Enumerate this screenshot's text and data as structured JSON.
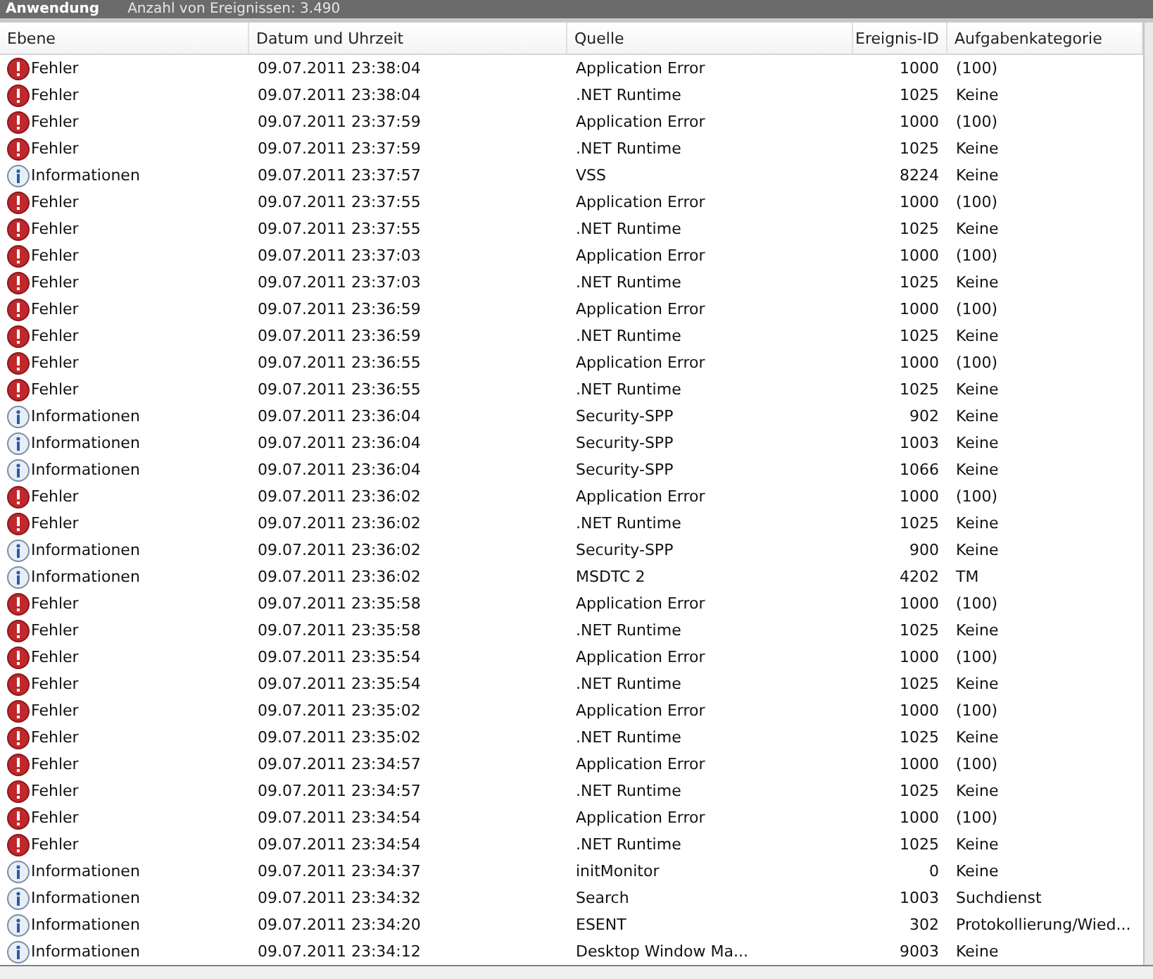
{
  "header": {
    "title": "Anwendung",
    "count": "Anzahl von Ereignissen: 3.490"
  },
  "table": {
    "columns": [
      "Ebene",
      "Datum und Uhrzeit",
      "Quelle",
      "Ereignis-ID",
      "Aufgabenkategorie"
    ],
    "rows": [
      {
        "kind": "error",
        "level": "Fehler",
        "date": "09.07.2011 23:38:04",
        "source": "Application Error",
        "id": "1000",
        "category": "(100)"
      },
      {
        "kind": "error",
        "level": "Fehler",
        "date": "09.07.2011 23:38:04",
        "source": ".NET Runtime",
        "id": "1025",
        "category": "Keine"
      },
      {
        "kind": "error",
        "level": "Fehler",
        "date": "09.07.2011 23:37:59",
        "source": "Application Error",
        "id": "1000",
        "category": "(100)"
      },
      {
        "kind": "error",
        "level": "Fehler",
        "date": "09.07.2011 23:37:59",
        "source": ".NET Runtime",
        "id": "1025",
        "category": "Keine"
      },
      {
        "kind": "info",
        "level": "Informationen",
        "date": "09.07.2011 23:37:57",
        "source": "VSS",
        "id": "8224",
        "category": "Keine"
      },
      {
        "kind": "error",
        "level": "Fehler",
        "date": "09.07.2011 23:37:55",
        "source": "Application Error",
        "id": "1000",
        "category": "(100)"
      },
      {
        "kind": "error",
        "level": "Fehler",
        "date": "09.07.2011 23:37:55",
        "source": ".NET Runtime",
        "id": "1025",
        "category": "Keine"
      },
      {
        "kind": "error",
        "level": "Fehler",
        "date": "09.07.2011 23:37:03",
        "source": "Application Error",
        "id": "1000",
        "category": "(100)"
      },
      {
        "kind": "error",
        "level": "Fehler",
        "date": "09.07.2011 23:37:03",
        "source": ".NET Runtime",
        "id": "1025",
        "category": "Keine"
      },
      {
        "kind": "error",
        "level": "Fehler",
        "date": "09.07.2011 23:36:59",
        "source": "Application Error",
        "id": "1000",
        "category": "(100)"
      },
      {
        "kind": "error",
        "level": "Fehler",
        "date": "09.07.2011 23:36:59",
        "source": ".NET Runtime",
        "id": "1025",
        "category": "Keine"
      },
      {
        "kind": "error",
        "level": "Fehler",
        "date": "09.07.2011 23:36:55",
        "source": "Application Error",
        "id": "1000",
        "category": "(100)"
      },
      {
        "kind": "error",
        "level": "Fehler",
        "date": "09.07.2011 23:36:55",
        "source": ".NET Runtime",
        "id": "1025",
        "category": "Keine"
      },
      {
        "kind": "info",
        "level": "Informationen",
        "date": "09.07.2011 23:36:04",
        "source": "Security-SPP",
        "id": "902",
        "category": "Keine"
      },
      {
        "kind": "info",
        "level": "Informationen",
        "date": "09.07.2011 23:36:04",
        "source": "Security-SPP",
        "id": "1003",
        "category": "Keine"
      },
      {
        "kind": "info",
        "level": "Informationen",
        "date": "09.07.2011 23:36:04",
        "source": "Security-SPP",
        "id": "1066",
        "category": "Keine"
      },
      {
        "kind": "error",
        "level": "Fehler",
        "date": "09.07.2011 23:36:02",
        "source": "Application Error",
        "id": "1000",
        "category": "(100)"
      },
      {
        "kind": "error",
        "level": "Fehler",
        "date": "09.07.2011 23:36:02",
        "source": ".NET Runtime",
        "id": "1025",
        "category": "Keine"
      },
      {
        "kind": "info",
        "level": "Informationen",
        "date": "09.07.2011 23:36:02",
        "source": "Security-SPP",
        "id": "900",
        "category": "Keine"
      },
      {
        "kind": "info",
        "level": "Informationen",
        "date": "09.07.2011 23:36:02",
        "source": "MSDTC 2",
        "id": "4202",
        "category": "TM"
      },
      {
        "kind": "error",
        "level": "Fehler",
        "date": "09.07.2011 23:35:58",
        "source": "Application Error",
        "id": "1000",
        "category": "(100)"
      },
      {
        "kind": "error",
        "level": "Fehler",
        "date": "09.07.2011 23:35:58",
        "source": ".NET Runtime",
        "id": "1025",
        "category": "Keine"
      },
      {
        "kind": "error",
        "level": "Fehler",
        "date": "09.07.2011 23:35:54",
        "source": "Application Error",
        "id": "1000",
        "category": "(100)"
      },
      {
        "kind": "error",
        "level": "Fehler",
        "date": "09.07.2011 23:35:54",
        "source": ".NET Runtime",
        "id": "1025",
        "category": "Keine"
      },
      {
        "kind": "error",
        "level": "Fehler",
        "date": "09.07.2011 23:35:02",
        "source": "Application Error",
        "id": "1000",
        "category": "(100)"
      },
      {
        "kind": "error",
        "level": "Fehler",
        "date": "09.07.2011 23:35:02",
        "source": ".NET Runtime",
        "id": "1025",
        "category": "Keine"
      },
      {
        "kind": "error",
        "level": "Fehler",
        "date": "09.07.2011 23:34:57",
        "source": "Application Error",
        "id": "1000",
        "category": "(100)"
      },
      {
        "kind": "error",
        "level": "Fehler",
        "date": "09.07.2011 23:34:57",
        "source": ".NET Runtime",
        "id": "1025",
        "category": "Keine"
      },
      {
        "kind": "error",
        "level": "Fehler",
        "date": "09.07.2011 23:34:54",
        "source": "Application Error",
        "id": "1000",
        "category": "(100)"
      },
      {
        "kind": "error",
        "level": "Fehler",
        "date": "09.07.2011 23:34:54",
        "source": ".NET Runtime",
        "id": "1025",
        "category": "Keine"
      },
      {
        "kind": "info",
        "level": "Informationen",
        "date": "09.07.2011 23:34:37",
        "source": "initMonitor",
        "id": "0",
        "category": "Keine"
      },
      {
        "kind": "info",
        "level": "Informationen",
        "date": "09.07.2011 23:34:32",
        "source": "Search",
        "id": "1003",
        "category": "Suchdienst"
      },
      {
        "kind": "info",
        "level": "Informationen",
        "date": "09.07.2011 23:34:20",
        "source": "ESENT",
        "id": "302",
        "category": "Protokollierung/Wied..."
      },
      {
        "kind": "info",
        "level": "Informationen",
        "date": "09.07.2011 23:34:12",
        "source": "Desktop Window Ma...",
        "id": "9003",
        "category": "Keine"
      }
    ]
  }
}
